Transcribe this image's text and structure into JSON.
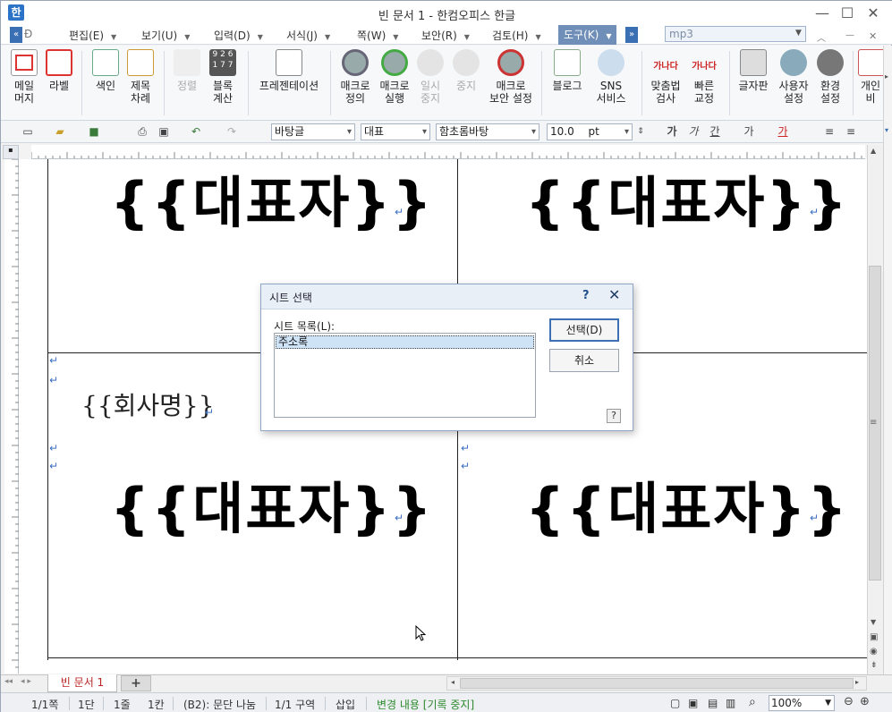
{
  "window": {
    "title": "빈 문서 1 - 한컴오피스 한글",
    "app_icon": "한",
    "minimize": "—",
    "maximize": "☐",
    "close": "✕"
  },
  "menu": {
    "items": [
      "편집(E)",
      "보기(U)",
      "입력(D)",
      "서식(J)",
      "쪽(W)",
      "보안(R)",
      "검토(H)",
      "도구(K)"
    ],
    "search_value": "mp3"
  },
  "ribbon": {
    "mail": "메일\n머지",
    "label": "라벨",
    "index": "색인",
    "toc": "제목\n차례",
    "sort": "정렬",
    "block_calc": "블록\n계산",
    "presentation": "프레젠테이션",
    "macro_define": "매크로\n정의",
    "macro_run": "매크로\n실행",
    "pause": "일시\n중지",
    "stop": "중지",
    "macro_security": "매크로\n보안 설정",
    "blog": "블로그",
    "sns": "SNS\n서비스",
    "spellcheck": "맞춤법\n검사",
    "quick_fix": "빠른\n교정",
    "keyboard": "글자판",
    "user_settings": "사용자\n설정",
    "env_settings": "환경\n설정",
    "more": "개인\n비"
  },
  "format_bar": {
    "style": "바탕글",
    "lang": "대표",
    "font": "함초롬바탕",
    "size": "10.0",
    "unit": "pt"
  },
  "document": {
    "field_rep": "{{대표자}}",
    "field_company": "{{회사명}}",
    "para_mark": "↵"
  },
  "dialog": {
    "title": "시트 선택",
    "help": "?",
    "close": "✕",
    "list_label": "시트 목록(L):",
    "items": [
      "주소록"
    ],
    "select_button": "선택(D)",
    "cancel_button": "취소",
    "help_icon": "?"
  },
  "tabs": {
    "doc_tab": "빈 문서 1",
    "add": "+"
  },
  "status": {
    "page": "1/1쪽",
    "column": "1단",
    "line": "1줄",
    "char": "1칸",
    "context": "(B2): 문단 나눔",
    "section": "1/1 구역",
    "mode": "삽입",
    "track": "변경 내용 [기록 중지]",
    "zoom": "100%"
  },
  "colors": {
    "accent": "#3c6fb3",
    "para_mark": "#3c6fc4",
    "track_text": "#2d8a2d",
    "tab_text": "#b22222"
  }
}
